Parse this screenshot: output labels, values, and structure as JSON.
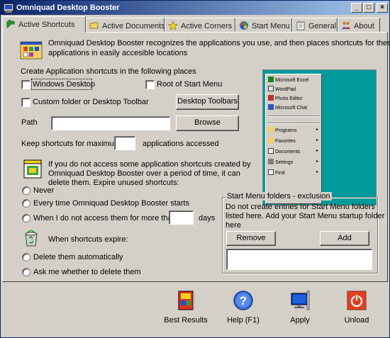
{
  "window": {
    "title": "Omniquad Desktop Booster",
    "controls": {
      "minimize": "_",
      "maximize": "□",
      "close": "×"
    }
  },
  "tabs": [
    {
      "label": "Active Shortcuts",
      "icon": "green-arrow-icon",
      "active": true
    },
    {
      "label": "Active Documents",
      "icon": "folder-icon",
      "active": false
    },
    {
      "label": "Active Corners",
      "icon": "star-icon",
      "active": false
    },
    {
      "label": "Start Menu",
      "icon": "start-menu-icon",
      "active": false
    },
    {
      "label": "General",
      "icon": "clipboard-icon",
      "active": false
    },
    {
      "label": "About",
      "icon": "people-icon",
      "active": false
    }
  ],
  "intro": {
    "text_line1": "Omniquad Desktop Booster recognizes the applications you use, and then places shortcuts for these",
    "text_line2": "applications in easily accesible locations"
  },
  "create": {
    "heading": "Create Application shortcuts in the following places",
    "windows_desktop": "Windows Desktop",
    "root_start_menu": "Root of Start Menu",
    "custom_folder": "Custom folder or Desktop Toolbar",
    "desktop_toolbars_button": "Desktop Toolbars",
    "path_label": "Path",
    "path_value": "",
    "browse_button": "Browse",
    "keep_label": "Keep shortcuts for maximum",
    "keep_value": "",
    "keep_suffix": "applications accessed"
  },
  "expire": {
    "text_line1": "If you do not access some application shortcuts created by",
    "text_line2": "Omniquad Desktop Booster over a period of time, it can",
    "text_line3": "delete them.  Expire unused shortcuts:",
    "never": "Never",
    "every_time": "Every time Omniquad Desktop Booster starts",
    "when_not_accessed": "When I do not access them for more than",
    "days_value": "",
    "days_suffix": "days"
  },
  "when_expire": {
    "heading": "When shortcuts expire:",
    "delete_auto": "Delete them automatically",
    "ask": "Ask me whether to delete them"
  },
  "exclusion": {
    "title": "Start Menu folders - exclusion",
    "text_line1": "Do not create entries for Start Menu folders",
    "text_line2": "listed here.  Add your Start Menu startup folder",
    "text_line3": "here",
    "remove_button": "Remove",
    "add_button": "Add"
  },
  "preview_menu": {
    "items": [
      "Microsoft Excel",
      "WordPad",
      "Photo Editor",
      "Microsoft Chat"
    ],
    "submenus": [
      "Programs",
      "Favorites",
      "Documents",
      "Settings",
      "Find"
    ],
    "arrow": "▸"
  },
  "bottom_buttons": [
    {
      "label": "Best Results",
      "icon": "book-icon"
    },
    {
      "label": "Help (F1)",
      "icon": "help-icon"
    },
    {
      "label": "Apply",
      "icon": "monitor-icon"
    },
    {
      "label": "Unload",
      "icon": "power-icon"
    }
  ],
  "colors": {
    "titlebar_start": "#0a246a",
    "titlebar_end": "#a6caf0",
    "preview_bg": "#009a9a",
    "face": "#d4d0c8"
  }
}
